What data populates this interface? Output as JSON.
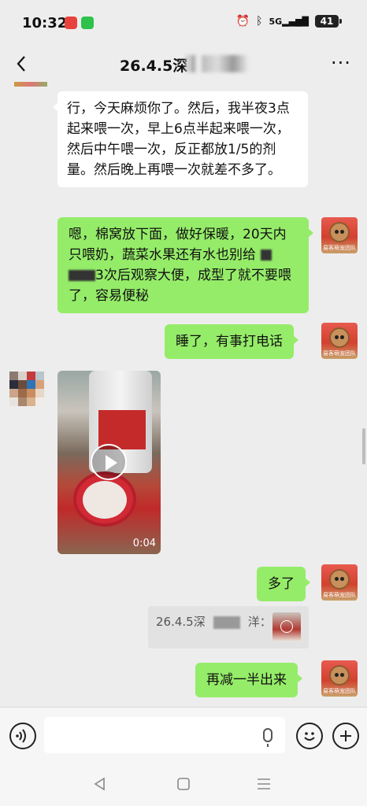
{
  "status": {
    "time": "10:32",
    "network": "5G",
    "battery": "41"
  },
  "header": {
    "title": "26.4.5深",
    "more": "···"
  },
  "avatar_self": {
    "tag": "易客萌宠团队"
  },
  "messages": {
    "m1": "行，今天麻烦你了。然后，我半夜3点起来喂一次，早上6点半起来喂一次，然后中午喂一次，反正都放1/5的剂量。然后晚上再喂一次就差不多了。",
    "m2_line1": "嗯，棉窝放下面，做好保暖，20天内只喂奶，蔬菜水果还有水也别给",
    "m2_line2": "3次后观察大便，成型了就不要喂了，容易便秘",
    "m3": "睡了，有事打电话",
    "video_duration": "0:04",
    "m4": "多了",
    "quote_prefix": "26.4.5深",
    "quote_suffix": "洋：",
    "m5": "再减一半出来"
  },
  "input": {
    "placeholder": ""
  },
  "colors": {
    "bubble_out": "#95ec69",
    "bubble_in": "#ffffff",
    "background": "#ededed"
  }
}
